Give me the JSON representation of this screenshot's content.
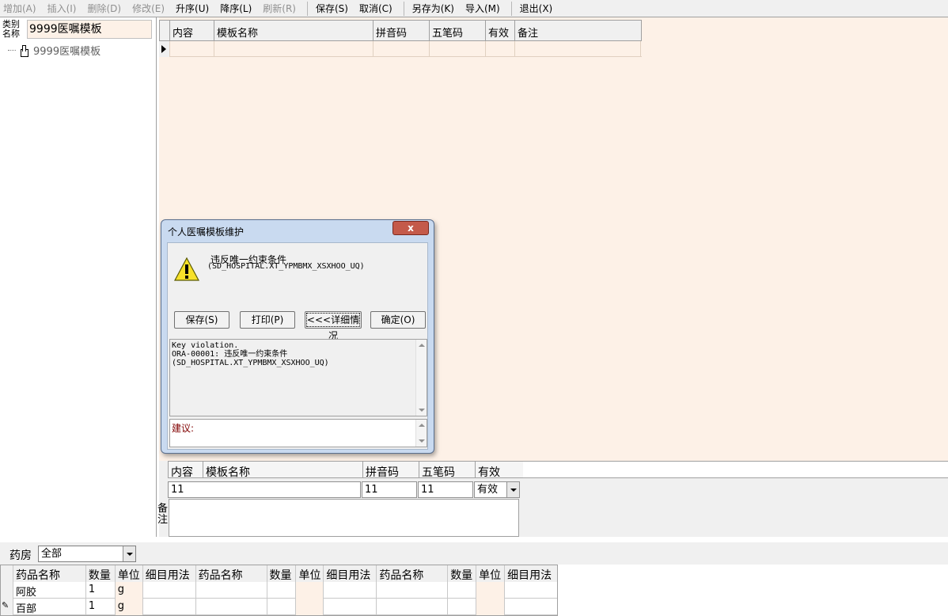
{
  "toolbar": {
    "add": "增加(A)",
    "insert": "插入(I)",
    "delete": "删除(D)",
    "modify": "修改(E)",
    "asc": "升序(U)",
    "desc": "降序(L)",
    "refresh": "刷新(R)",
    "save": "保存(S)",
    "cancel": "取消(C)",
    "save_as": "另存为(K)",
    "import": "导入(M)",
    "exit": "退出(X)"
  },
  "left": {
    "category_label": "类别名称",
    "category_value": "9999医嘱模板",
    "tree_item": "9999医嘱模板"
  },
  "grid": {
    "columns": [
      "内容",
      "模板名称",
      "拼音码",
      "五笔码",
      "有效",
      "备注"
    ]
  },
  "edit": {
    "columns": [
      "内容",
      "模板名称",
      "拼音码",
      "五笔码",
      "有效"
    ],
    "content_value": "11",
    "pinyin_value": "11",
    "wubi_value": "11",
    "valid_value": "有效",
    "memo_label": "备注"
  },
  "bottom": {
    "pharmacy_label": "药房",
    "pharmacy_value": "全部",
    "columns": [
      "药品名称",
      "数量",
      "单位",
      "细目用法",
      "药品名称",
      "数量",
      "单位",
      "细目用法",
      "药品名称",
      "数量",
      "单位",
      "细目用法"
    ],
    "rows": [
      {
        "name": "阿胶",
        "qty": "1",
        "unit": "g"
      },
      {
        "name": "百部",
        "qty": "1",
        "unit": "g"
      }
    ]
  },
  "dialog": {
    "title": "个人医嘱模板维护",
    "close": "x",
    "message": "违反唯一约束条件",
    "message_detail": "(SD_HOSPITAL.XT_YPMBMX_XSXHOO_UQ)",
    "btn_save": "保存(S)",
    "btn_print": "打印(P)",
    "btn_details": "<<<详细情况",
    "btn_ok": "确定(O)",
    "detail_text": "Key violation.\nORA-00001: 违反唯一约束条件\n(SD_HOSPITAL.XT_YPMBMX_XSXHOO_UQ)",
    "suggest_label": "建议:"
  }
}
